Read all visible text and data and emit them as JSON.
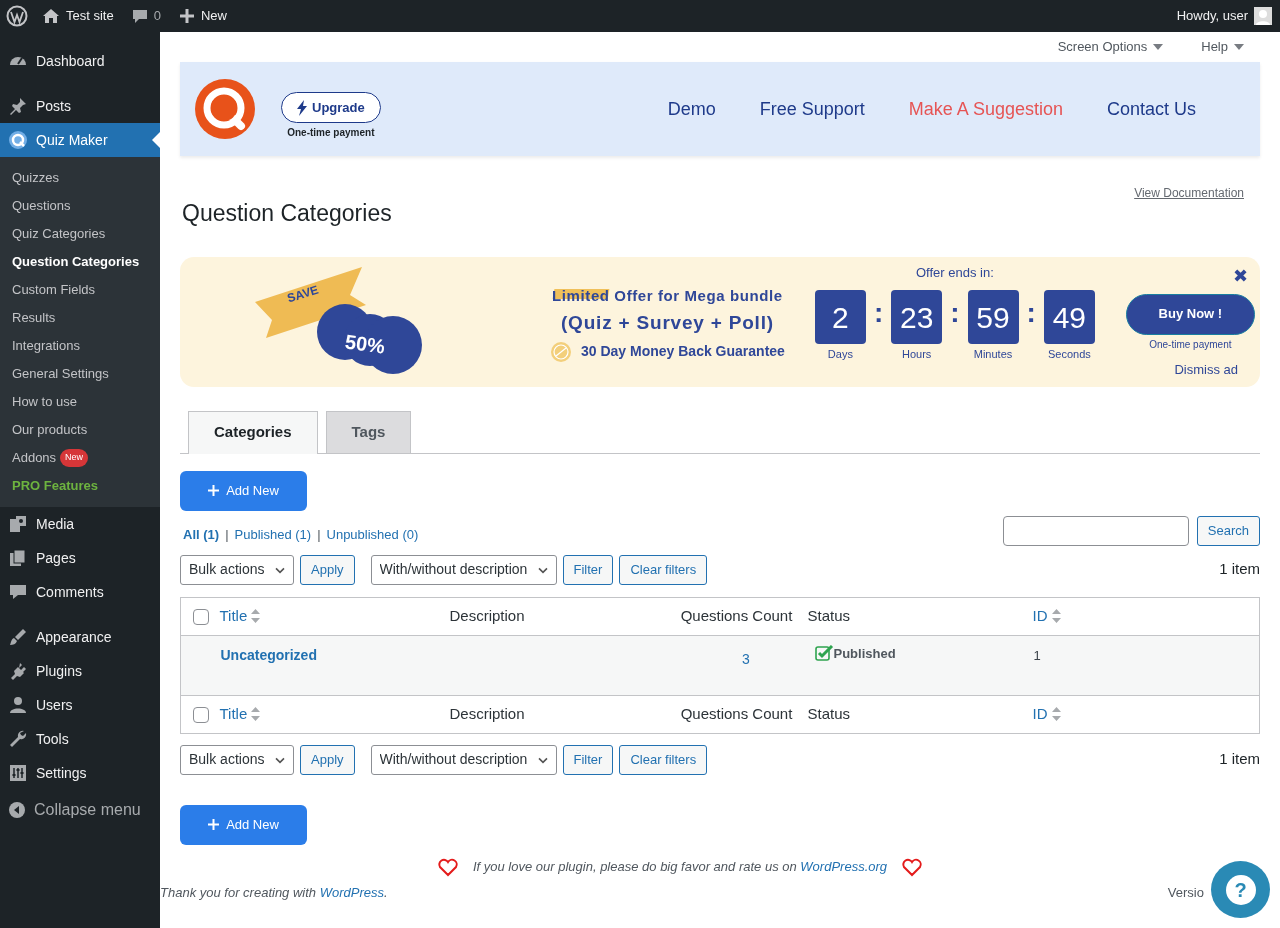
{
  "admin_bar": {
    "site": "Test site",
    "comments": "0",
    "new": "New",
    "greeting": "Howdy, user"
  },
  "sidebar": {
    "groups": [
      [
        {
          "label": "Dashboard",
          "selected": false
        }
      ],
      [
        {
          "label": "Posts",
          "selected": false
        },
        {
          "label": "Quiz Maker",
          "selected": true,
          "children": [
            {
              "label": "Quizzes",
              "selected": false,
              "kind": "link"
            },
            {
              "label": "Questions",
              "selected": false,
              "kind": "link"
            },
            {
              "label": "Quiz Categories",
              "selected": false,
              "kind": "link"
            },
            {
              "label": "Question Categories",
              "selected": true,
              "kind": "link"
            },
            {
              "label": "Custom Fields",
              "selected": false,
              "kind": "link"
            },
            {
              "label": "Results",
              "selected": false,
              "kind": "link"
            },
            {
              "label": "Integrations",
              "selected": false,
              "kind": "link"
            },
            {
              "label": "General Settings",
              "selected": false,
              "kind": "link"
            },
            {
              "label": "How to use",
              "selected": false,
              "kind": "link"
            },
            {
              "label": "Our products",
              "selected": false,
              "kind": "link"
            },
            {
              "label": "Addons",
              "selected": false,
              "kind": "link",
              "badge": "New"
            },
            {
              "label": "PRO Features",
              "selected": false,
              "kind": "pro"
            }
          ]
        },
        {
          "label": "Media",
          "selected": false
        },
        {
          "label": "Pages",
          "selected": false
        },
        {
          "label": "Comments",
          "selected": false
        }
      ],
      [
        {
          "label": "Appearance",
          "selected": false
        },
        {
          "label": "Plugins",
          "selected": false
        },
        {
          "label": "Users",
          "selected": false
        },
        {
          "label": "Tools",
          "selected": false
        },
        {
          "label": "Settings",
          "selected": false
        }
      ]
    ],
    "collapse": "Collapse menu"
  },
  "screen_meta": [
    "Screen Options",
    "Help"
  ],
  "plugin_header": {
    "upgrade": "Upgrade",
    "upgrade_note": "One-time payment",
    "links": [
      {
        "label": "Demo",
        "color": "#1e3a8a"
      },
      {
        "label": "Free Support",
        "color": "#1e3a8a"
      },
      {
        "label": "Make A Suggestion",
        "color": "#e65454"
      },
      {
        "label": "Contact Us",
        "color": "#1e3a8a"
      }
    ]
  },
  "view_docs": "View Documentation",
  "page_title": "Question Categories",
  "promo": {
    "save": "SAVE",
    "discount": "50%",
    "headline_highlight": "Limited",
    "headline_rest": "Offer for Mega bundle",
    "bundle": "(Quiz + Survey + Poll)",
    "guarantee": "30 Day Money Back Guarantee",
    "offer_label": "Offer ends in:",
    "countdown": [
      {
        "value": "2",
        "unit": "Days"
      },
      {
        "value": "23",
        "unit": "Hours",
        "separator": ":"
      },
      {
        "value": "59",
        "unit": "Minutes",
        "separator": ":"
      },
      {
        "value": "49",
        "unit": "Seconds",
        "separator": ":"
      }
    ],
    "buy": "Buy Now !",
    "buy_note": "One-time payment",
    "close": "✖",
    "dismiss": "Dismiss ad"
  },
  "tabs": [
    {
      "label": "Categories",
      "selected": true
    },
    {
      "label": "Tags",
      "selected": false
    }
  ],
  "add_new_top": "Add New",
  "views": [
    {
      "label": "All (1)",
      "selected": true
    },
    {
      "label": "Published (1)",
      "selected": false,
      "separator": "|"
    },
    {
      "label": "Unpublished (0)",
      "selected": false,
      "separator": "|"
    }
  ],
  "search_button": "Search",
  "nav_top": {
    "bulk": "Bulk actions",
    "apply": "Apply",
    "filter_select": "With/without description",
    "filter": "Filter",
    "clear": "Clear filters",
    "count": "1 item"
  },
  "table": {
    "header": {
      "checked": false,
      "columns": [
        {
          "label": "Title",
          "sortable": true
        },
        {
          "label": "Description",
          "sortable": false
        },
        {
          "label": "Questions Count",
          "sortable": false
        },
        {
          "label": "Status",
          "sortable": false
        },
        {
          "label": "ID",
          "sortable": true
        }
      ]
    },
    "rows": [
      {
        "title": "Uncategorized",
        "questions_count": "3",
        "status": "Published",
        "id": "1"
      }
    ],
    "footer": {
      "checked": false,
      "columns": [
        {
          "label": "Title",
          "sortable": true
        },
        {
          "label": "Description",
          "sortable": false
        },
        {
          "label": "Questions Count",
          "sortable": false
        },
        {
          "label": "Status",
          "sortable": false
        },
        {
          "label": "ID",
          "sortable": true
        }
      ]
    }
  },
  "nav_bottom": {
    "bulk": "Bulk actions",
    "apply": "Apply",
    "filter_select": "With/without description",
    "filter": "Filter",
    "clear": "Clear filters",
    "count": "1 item"
  },
  "add_new_bottom": "Add New",
  "rate": {
    "text": "If you love our plugin, please do big favor and rate us on ",
    "link": "WordPress.org"
  },
  "footer": {
    "text": "Thank you for creating with ",
    "link": "WordPress",
    "end": ".",
    "version": "Versio"
  },
  "help_bubble": "?"
}
